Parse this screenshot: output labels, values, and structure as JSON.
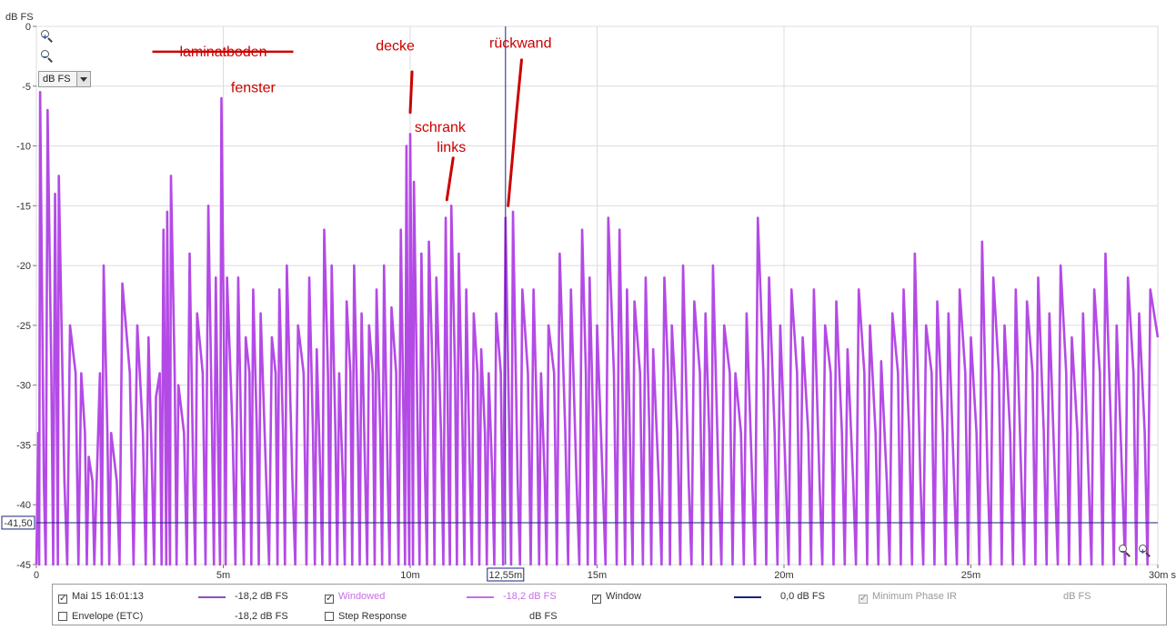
{
  "chart_data": {
    "type": "line",
    "ylabel": "dB FS",
    "xlim": [
      0,
      30
    ],
    "ylim": [
      -45,
      0
    ],
    "x_ticks": [
      "0",
      "5m",
      "10m",
      "15m",
      "20m",
      "25m",
      "30m s"
    ],
    "y_ticks": [
      "0",
      "-5",
      "-10",
      "-15",
      "-20",
      "-25",
      "-30",
      "-35",
      "-40",
      "-45"
    ],
    "grid": true,
    "cursor": {
      "x": 12.55,
      "x_label": "12,55m",
      "y": -41.5,
      "y_label": "-41,50"
    },
    "series": [
      {
        "name": "Windowed",
        "color": "#b44ae6",
        "noise_floor": -45,
        "peaks": [
          [
            0.1,
            -5.5
          ],
          [
            0.3,
            -7
          ],
          [
            0.5,
            -14
          ],
          [
            0.6,
            -12.5
          ],
          [
            0.9,
            -25
          ],
          [
            1.2,
            -29
          ],
          [
            1.4,
            -36
          ],
          [
            1.6,
            -39.5
          ],
          [
            1.8,
            -20
          ],
          [
            2.0,
            -34
          ],
          [
            2.3,
            -21.5
          ],
          [
            2.7,
            -25
          ],
          [
            3.0,
            -26
          ],
          [
            3.2,
            -31
          ],
          [
            3.4,
            -17
          ],
          [
            3.5,
            -15.5
          ],
          [
            3.6,
            -12.5
          ],
          [
            3.8,
            -30
          ],
          [
            4.1,
            -19
          ],
          [
            4.3,
            -24
          ],
          [
            4.6,
            -15
          ],
          [
            4.8,
            -21
          ],
          [
            4.95,
            -6
          ],
          [
            5.1,
            -21
          ],
          [
            5.4,
            -21
          ],
          [
            5.6,
            -26
          ],
          [
            5.8,
            -22
          ],
          [
            6.0,
            -24
          ],
          [
            6.3,
            -26
          ],
          [
            6.5,
            -22
          ],
          [
            6.7,
            -20
          ],
          [
            7.0,
            -25
          ],
          [
            7.3,
            -21
          ],
          [
            7.5,
            -27
          ],
          [
            7.7,
            -17
          ],
          [
            7.9,
            -20
          ],
          [
            8.1,
            -29
          ],
          [
            8.3,
            -23
          ],
          [
            8.5,
            -20
          ],
          [
            8.7,
            -24
          ],
          [
            8.9,
            -25
          ],
          [
            9.1,
            -22
          ],
          [
            9.3,
            -20
          ],
          [
            9.5,
            -23.5
          ],
          [
            9.75,
            -17
          ],
          [
            9.9,
            -10
          ],
          [
            10.0,
            -9
          ],
          [
            10.1,
            -13
          ],
          [
            10.3,
            -19
          ],
          [
            10.5,
            -18
          ],
          [
            10.7,
            -21
          ],
          [
            10.95,
            -16
          ],
          [
            11.1,
            -15
          ],
          [
            11.3,
            -19
          ],
          [
            11.5,
            -22
          ],
          [
            11.7,
            -24
          ],
          [
            11.9,
            -27
          ],
          [
            12.1,
            -29
          ],
          [
            12.3,
            -24
          ],
          [
            12.55,
            -16
          ],
          [
            12.75,
            -15.5
          ],
          [
            13.0,
            -22
          ],
          [
            13.3,
            -22
          ],
          [
            13.5,
            -29
          ],
          [
            13.7,
            -25
          ],
          [
            14.0,
            -19
          ],
          [
            14.3,
            -22
          ],
          [
            14.6,
            -17
          ],
          [
            14.8,
            -21
          ],
          [
            15.0,
            -25
          ],
          [
            15.3,
            -16
          ],
          [
            15.6,
            -17
          ],
          [
            15.8,
            -22
          ],
          [
            16.0,
            -23
          ],
          [
            16.3,
            -21
          ],
          [
            16.5,
            -27
          ],
          [
            16.8,
            -21
          ],
          [
            17.0,
            -25
          ],
          [
            17.3,
            -20
          ],
          [
            17.6,
            -23
          ],
          [
            17.9,
            -24
          ],
          [
            18.1,
            -20
          ],
          [
            18.4,
            -25
          ],
          [
            18.7,
            -29
          ],
          [
            19.0,
            -24
          ],
          [
            19.3,
            -16
          ],
          [
            19.6,
            -21
          ],
          [
            19.9,
            -25
          ],
          [
            20.2,
            -22
          ],
          [
            20.5,
            -26
          ],
          [
            20.8,
            -22
          ],
          [
            21.1,
            -25
          ],
          [
            21.4,
            -23
          ],
          [
            21.7,
            -27
          ],
          [
            22.0,
            -22
          ],
          [
            22.3,
            -25
          ],
          [
            22.6,
            -28
          ],
          [
            22.9,
            -24
          ],
          [
            23.2,
            -22
          ],
          [
            23.5,
            -19
          ],
          [
            23.8,
            -25
          ],
          [
            24.1,
            -23
          ],
          [
            24.4,
            -24
          ],
          [
            24.7,
            -22
          ],
          [
            25.0,
            -26
          ],
          [
            25.3,
            -18
          ],
          [
            25.6,
            -21
          ],
          [
            25.9,
            -25
          ],
          [
            26.2,
            -22
          ],
          [
            26.5,
            -23
          ],
          [
            26.8,
            -21
          ],
          [
            27.1,
            -24
          ],
          [
            27.4,
            -20
          ],
          [
            27.7,
            -26
          ],
          [
            28.0,
            -24
          ],
          [
            28.3,
            -22
          ],
          [
            28.6,
            -19
          ],
          [
            28.9,
            -25
          ],
          [
            29.2,
            -21
          ],
          [
            29.5,
            -24
          ],
          [
            29.8,
            -22
          ]
        ]
      }
    ],
    "annotations": [
      {
        "text": "laminatboden",
        "x": 5.0,
        "y": -2.5,
        "strikethrough": true
      },
      {
        "text": "fenster",
        "x": 5.8,
        "y": -5.5
      },
      {
        "text": "decke",
        "x": 9.6,
        "y": -2.0
      },
      {
        "text": "schrank",
        "x": 10.8,
        "y": -8.8
      },
      {
        "text": "links",
        "x": 11.1,
        "y": -10.5
      },
      {
        "text": "rückwand",
        "x": 12.95,
        "y": -1.8
      }
    ]
  },
  "dropdown": {
    "value": "dB FS"
  },
  "legend": {
    "item1": {
      "checked": true,
      "label": "Mai 15 16:01:13",
      "value": "-18,2 dB FS",
      "color": "#8e4fc0"
    },
    "item2": {
      "checked": true,
      "label": "Windowed",
      "value": "-18,2 dB FS",
      "color": "#c86ee8"
    },
    "item3": {
      "checked": true,
      "label": "Window",
      "value": "0,0 dB FS",
      "color": "#1a237e"
    },
    "item4": {
      "checked": true,
      "label": "Minimum Phase IR",
      "value": "dB FS",
      "disabled": true
    },
    "item5": {
      "checked": false,
      "label": "Envelope (ETC)",
      "value": "-18,2 dB FS"
    },
    "item6": {
      "checked": false,
      "label": "Step Response",
      "value": "dB FS"
    }
  }
}
